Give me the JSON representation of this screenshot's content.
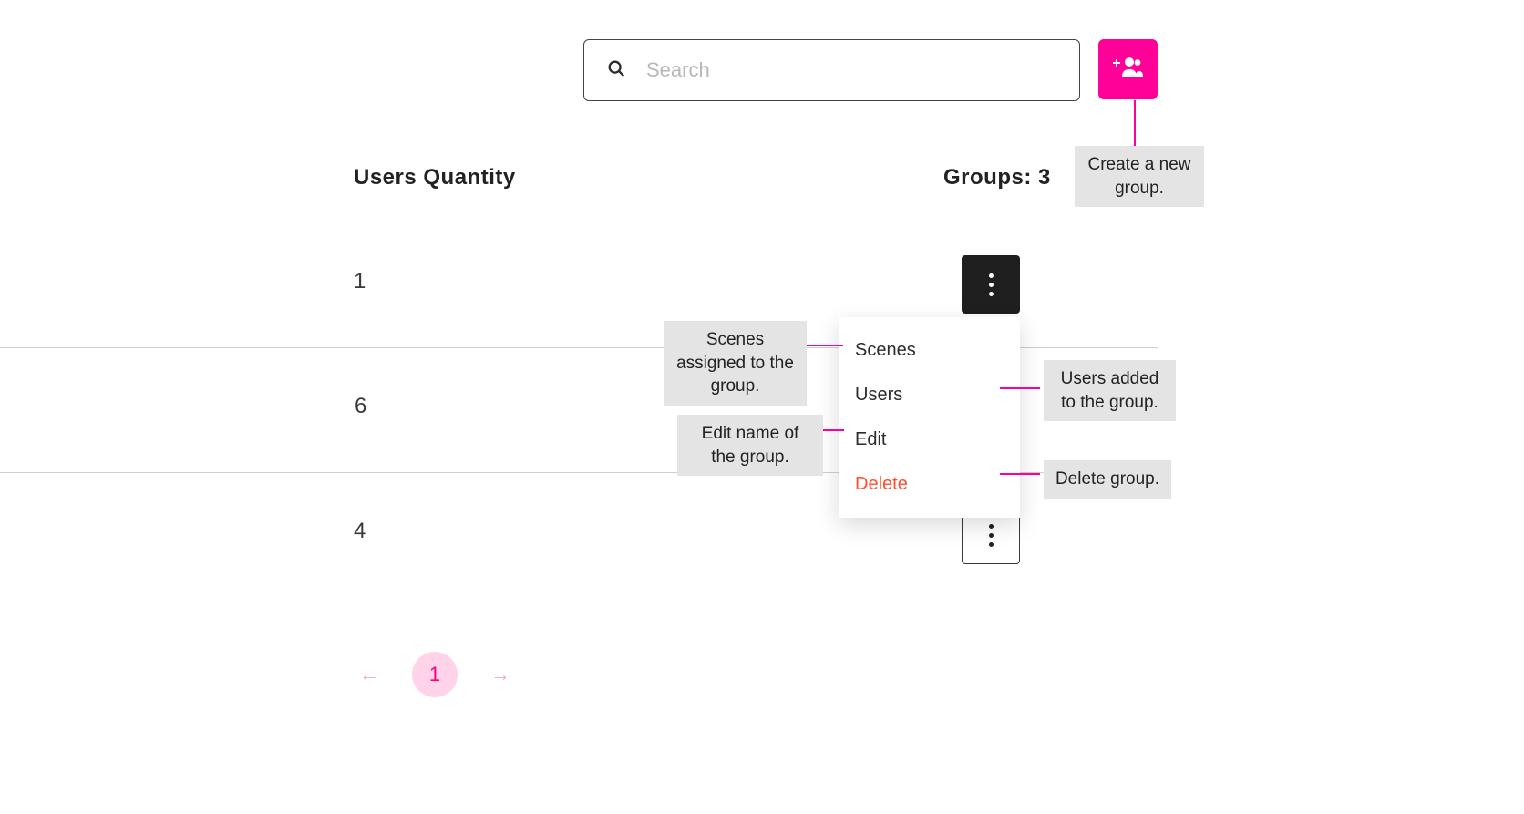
{
  "search": {
    "placeholder": "Search"
  },
  "headers": {
    "users_quantity": "Users Quantity",
    "groups_label": "Groups: 3"
  },
  "rows": [
    {
      "qty": "1"
    },
    {
      "qty": "6"
    },
    {
      "qty": "4"
    }
  ],
  "menu": {
    "scenes": "Scenes",
    "users": "Users",
    "edit": "Edit",
    "delete": "Delete"
  },
  "callouts": {
    "create": "Create a new group.",
    "scenes": "Scenes assigned to the group.",
    "users": "Users added to the group.",
    "edit": "Edit name of the group.",
    "delete": "Delete group."
  },
  "pagination": {
    "current": "1"
  }
}
